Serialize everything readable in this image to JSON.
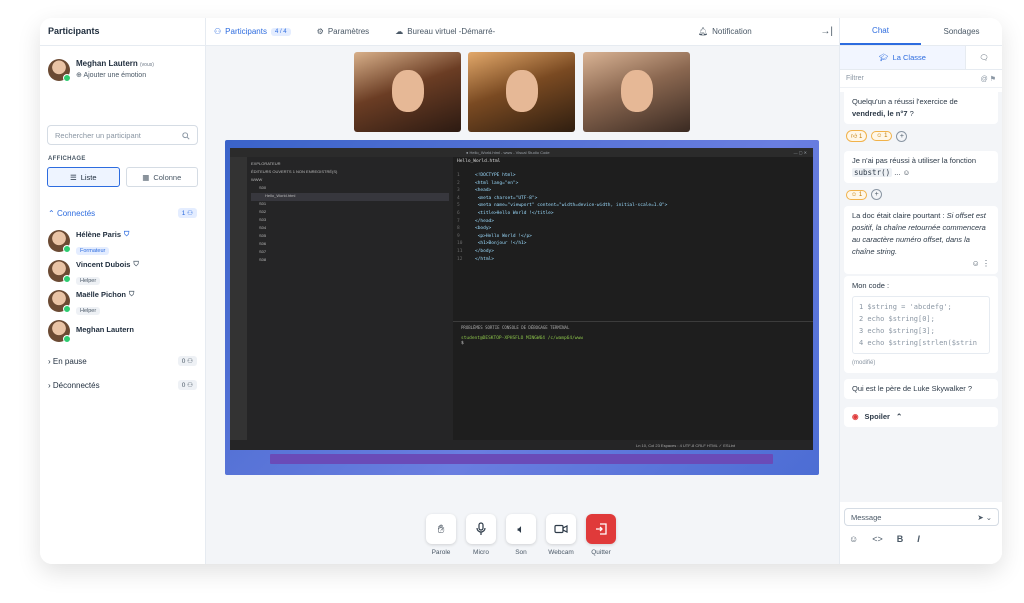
{
  "left": {
    "title": "Participants",
    "me": {
      "name": "Meghan Lautern",
      "you": "(vous)",
      "emotion": "Ajouter une émotion"
    },
    "search_placeholder": "Rechercher un participant",
    "display_title": "AFFICHAGE",
    "view_list": "Liste",
    "view_column": "Colonne",
    "connected": {
      "label": "Connectés",
      "count": "1"
    },
    "people": [
      {
        "name": "Hélène Paris",
        "role": "Formateur"
      },
      {
        "name": "Vincent Dubois",
        "role": "Helper"
      },
      {
        "name": "Maëlle Pichon",
        "role": "Helper"
      },
      {
        "name": "Meghan Lautern",
        "role": ""
      }
    ],
    "paused": {
      "label": "En pause",
      "count": "0"
    },
    "disconnected": {
      "label": "Déconnectés",
      "count": "0"
    }
  },
  "topbar": {
    "participants": "Participants",
    "participants_count": "4 / 4",
    "settings": "Paramètres",
    "desktop": "Bureau virtuel -Démarré-",
    "notification": "Notification"
  },
  "vscode": {
    "window_title": "● Hello_World.html - www - Visual Studio Code",
    "tab": "Hello_World.html",
    "code": [
      {
        "n": "1",
        "t": "<!DOCTYPE html>"
      },
      {
        "n": "2",
        "t": "<html lang=\"en\">"
      },
      {
        "n": "3",
        "t": "<head>"
      },
      {
        "n": "4",
        "t": "  <meta charset=\"UTF-8\">"
      },
      {
        "n": "5",
        "t": "  <meta name=\"viewport\" content=\"width=device-width, initial-scale=1.0\">"
      },
      {
        "n": "6",
        "t": "  <title>Hello World !</title>"
      },
      {
        "n": "7",
        "t": "</head>"
      },
      {
        "n": "8",
        "t": "<body>"
      },
      {
        "n": "9",
        "t": "  <p>Hello World !</p>"
      },
      {
        "n": "10",
        "t": "  <h1>Bonjour !</h1>"
      },
      {
        "n": "11",
        "t": "</body>"
      },
      {
        "n": "12",
        "t": "</html>"
      }
    ],
    "terminal_tabs": "PROBLÈMES   SORTIE   CONSOLE DE DÉBOGAGE   TERMINAL",
    "terminal_line": "student@DESKTOP-XPHSFLO MINGW64 /c/wamp64/www",
    "terminal_prompt": "$",
    "explorer": "EXPLORATEUR",
    "explorer_items": [
      "ÉDITEURS OUVERTS   1 NON ENREGISTRÉ(S)",
      "WWW",
      "S00",
      "Hello_World.html",
      "S01",
      "S02",
      "S03",
      "S04",
      "S05",
      "S06",
      "S07",
      "S08"
    ],
    "status": "Ln 10, Col 23   Espaces : 4   UTF-8   CRLF   HTML   ✓ ESLint"
  },
  "controls": [
    {
      "label": "Parole",
      "icon": "hand-icon"
    },
    {
      "label": "Micro",
      "icon": "mic-icon"
    },
    {
      "label": "Son",
      "icon": "speaker-icon"
    },
    {
      "label": "Webcam",
      "icon": "camera-icon"
    },
    {
      "label": "Quitter",
      "icon": "exit-icon"
    }
  ],
  "chat": {
    "tab_chat": "Chat",
    "tab_polls": "Sondages",
    "class_tab": "La Classe",
    "filter_placeholder": "Filtrer",
    "msg1_a": "Quelqu'un a réussi l'exercice de",
    "msg1_b": "vendredi, le n°7",
    "msg1_c": " ?",
    "react1": "1",
    "react2": "1",
    "msg2_a": "Je n'ai pas réussi à utiliser la fonction",
    "msg2_code": "substr()",
    "msg2_b": "...",
    "react3": "1",
    "msg3_a": "La doc était claire pourtant :",
    "msg3_b": "Si offset est positif, la chaîne retournée commencera au caractère numéro offset, dans la chaîne string.",
    "msg4_label": "Mon code :",
    "code_lines": [
      "1 $string = 'abcdefg';",
      "2 echo $string[0];",
      "3 echo $string[3];",
      "4 echo $string[strlen($strin"
    ],
    "modified": "(modifié)",
    "msg5": "Qui est le père de Luke Skywalker ?",
    "spoiler": "Spoiler",
    "message_placeholder": "Message"
  },
  "colors": {
    "accent": "#2d6cdf",
    "quit": "#e03a3a",
    "online": "#2ecc71"
  }
}
